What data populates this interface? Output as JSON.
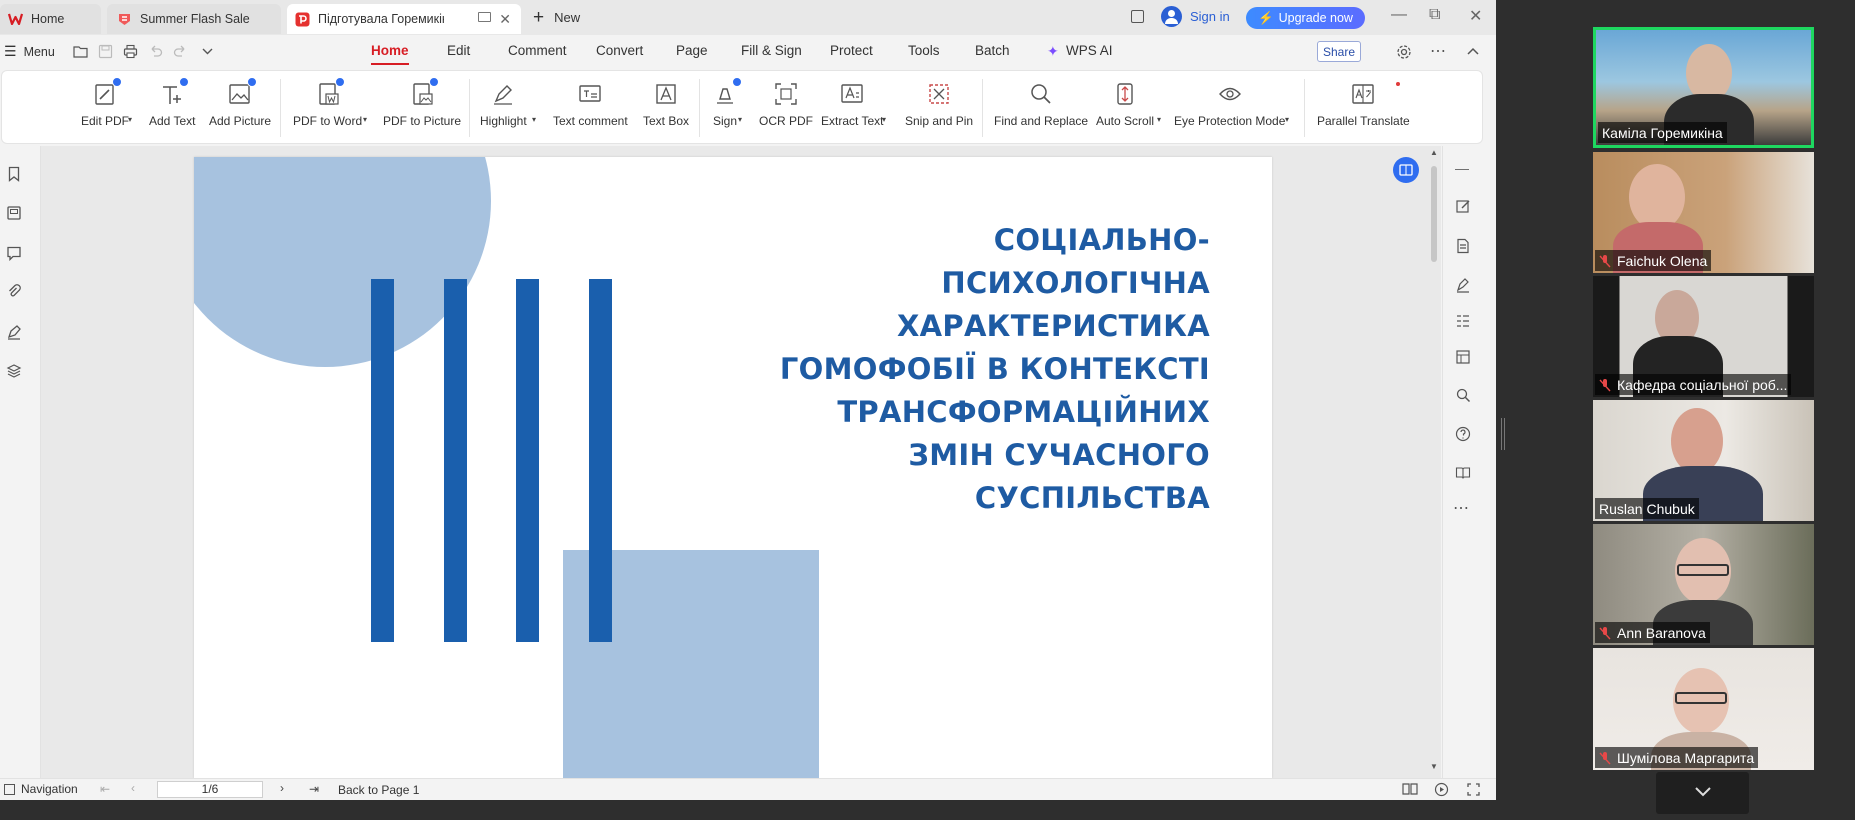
{
  "tabs": [
    {
      "label": "Home",
      "icon": "wps-logo-icon"
    },
    {
      "label": "Summer Flash Sale",
      "icon": "promo-icon"
    },
    {
      "label": "Підготувала Горемикіна кам",
      "icon": "pdf-icon"
    }
  ],
  "tabbar": {
    "new_label": "New",
    "signin_label": "Sign in",
    "upgrade_label": "Upgrade now"
  },
  "menubar": {
    "menu_label": "Menu",
    "tabs": [
      "Home",
      "Edit",
      "Comment",
      "Convert",
      "Page",
      "Fill & Sign",
      "Protect",
      "Tools",
      "Batch",
      "WPS AI"
    ],
    "share_label": "Share"
  },
  "ribbon": {
    "buttons": [
      {
        "label": "Edit PDF",
        "dropdown": true,
        "icon": "edit-pdf-icon"
      },
      {
        "label": "Add Text",
        "dropdown": false,
        "icon": "add-text-icon"
      },
      {
        "label": "Add Picture",
        "dropdown": false,
        "icon": "add-picture-icon"
      },
      {
        "label": "PDF to Word",
        "dropdown": true,
        "icon": "pdf-to-word-icon"
      },
      {
        "label": "PDF to Picture",
        "dropdown": false,
        "icon": "pdf-to-picture-icon"
      },
      {
        "label": "Highlight",
        "dropdown": true,
        "icon": "highlight-icon"
      },
      {
        "label": "Text comment",
        "dropdown": false,
        "icon": "text-comment-icon"
      },
      {
        "label": "Text Box",
        "dropdown": false,
        "icon": "text-box-icon"
      },
      {
        "label": "Sign",
        "dropdown": true,
        "icon": "sign-icon"
      },
      {
        "label": "OCR PDF",
        "dropdown": false,
        "icon": "ocr-icon"
      },
      {
        "label": "Extract Text",
        "dropdown": true,
        "icon": "extract-text-icon"
      },
      {
        "label": "Snip and Pin",
        "dropdown": false,
        "icon": "snip-icon"
      },
      {
        "label": "Find and Replace",
        "dropdown": false,
        "icon": "search-icon"
      },
      {
        "label": "Auto Scroll",
        "dropdown": true,
        "icon": "auto-scroll-icon"
      },
      {
        "label": "Eye Protection Mode",
        "dropdown": true,
        "icon": "eye-icon"
      },
      {
        "label": "Parallel Translate",
        "dropdown": false,
        "icon": "translate-icon"
      }
    ]
  },
  "document": {
    "title_lines": [
      "СОЦІАЛЬНО-",
      "ПСИХОЛОГІЧНА",
      "ХАРАКТЕРИСТИКА",
      "ГОМОФОБІЇ В КОНТЕКСТІ",
      "ТРАНСФОРМАЦІЙНИХ",
      "ЗМІН СУЧАСНОГО",
      "СУСПІЛЬСТВА"
    ],
    "colors": {
      "title": "#1e5ba3",
      "bar": "#1a5fad",
      "shape": "#a7c2df"
    }
  },
  "statusbar": {
    "navigation_label": "Navigation",
    "page_value": "1/6",
    "back_label": "Back to Page 1"
  },
  "participants": [
    {
      "name": "Каміла Горемикіна",
      "muted": false,
      "active": true
    },
    {
      "name": "Faichuk Olena",
      "muted": true,
      "active": false
    },
    {
      "name": "Кафедра соціальної роб...",
      "muted": true,
      "active": false
    },
    {
      "name": "Ruslan Chubuk",
      "muted": false,
      "active": false
    },
    {
      "name": "Ann Baranova",
      "muted": true,
      "active": false
    },
    {
      "name": "Шумілова Маргарита",
      "muted": true,
      "active": false
    }
  ]
}
